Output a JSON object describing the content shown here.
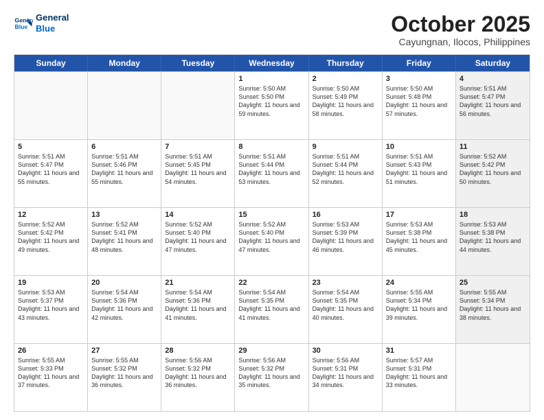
{
  "logo": {
    "line1": "General",
    "line2": "Blue"
  },
  "header": {
    "month": "October 2025",
    "location": "Cayungnan, Ilocos, Philippines"
  },
  "weekdays": [
    "Sunday",
    "Monday",
    "Tuesday",
    "Wednesday",
    "Thursday",
    "Friday",
    "Saturday"
  ],
  "weeks": [
    [
      {
        "day": "",
        "sunrise": "",
        "sunset": "",
        "daylight": "",
        "empty": true
      },
      {
        "day": "",
        "sunrise": "",
        "sunset": "",
        "daylight": "",
        "empty": true
      },
      {
        "day": "",
        "sunrise": "",
        "sunset": "",
        "daylight": "",
        "empty": true
      },
      {
        "day": "1",
        "sunrise": "Sunrise: 5:50 AM",
        "sunset": "Sunset: 5:50 PM",
        "daylight": "Daylight: 11 hours and 59 minutes."
      },
      {
        "day": "2",
        "sunrise": "Sunrise: 5:50 AM",
        "sunset": "Sunset: 5:49 PM",
        "daylight": "Daylight: 11 hours and 58 minutes."
      },
      {
        "day": "3",
        "sunrise": "Sunrise: 5:50 AM",
        "sunset": "Sunset: 5:48 PM",
        "daylight": "Daylight: 11 hours and 57 minutes."
      },
      {
        "day": "4",
        "sunrise": "Sunrise: 5:51 AM",
        "sunset": "Sunset: 5:47 PM",
        "daylight": "Daylight: 11 hours and 56 minutes.",
        "shaded": true
      }
    ],
    [
      {
        "day": "5",
        "sunrise": "Sunrise: 5:51 AM",
        "sunset": "Sunset: 5:47 PM",
        "daylight": "Daylight: 11 hours and 55 minutes."
      },
      {
        "day": "6",
        "sunrise": "Sunrise: 5:51 AM",
        "sunset": "Sunset: 5:46 PM",
        "daylight": "Daylight: 11 hours and 55 minutes."
      },
      {
        "day": "7",
        "sunrise": "Sunrise: 5:51 AM",
        "sunset": "Sunset: 5:45 PM",
        "daylight": "Daylight: 11 hours and 54 minutes."
      },
      {
        "day": "8",
        "sunrise": "Sunrise: 5:51 AM",
        "sunset": "Sunset: 5:44 PM",
        "daylight": "Daylight: 11 hours and 53 minutes."
      },
      {
        "day": "9",
        "sunrise": "Sunrise: 5:51 AM",
        "sunset": "Sunset: 5:44 PM",
        "daylight": "Daylight: 11 hours and 52 minutes."
      },
      {
        "day": "10",
        "sunrise": "Sunrise: 5:51 AM",
        "sunset": "Sunset: 5:43 PM",
        "daylight": "Daylight: 11 hours and 51 minutes."
      },
      {
        "day": "11",
        "sunrise": "Sunrise: 5:52 AM",
        "sunset": "Sunset: 5:42 PM",
        "daylight": "Daylight: 11 hours and 50 minutes.",
        "shaded": true
      }
    ],
    [
      {
        "day": "12",
        "sunrise": "Sunrise: 5:52 AM",
        "sunset": "Sunset: 5:42 PM",
        "daylight": "Daylight: 11 hours and 49 minutes."
      },
      {
        "day": "13",
        "sunrise": "Sunrise: 5:52 AM",
        "sunset": "Sunset: 5:41 PM",
        "daylight": "Daylight: 11 hours and 48 minutes."
      },
      {
        "day": "14",
        "sunrise": "Sunrise: 5:52 AM",
        "sunset": "Sunset: 5:40 PM",
        "daylight": "Daylight: 11 hours and 47 minutes."
      },
      {
        "day": "15",
        "sunrise": "Sunrise: 5:52 AM",
        "sunset": "Sunset: 5:40 PM",
        "daylight": "Daylight: 11 hours and 47 minutes."
      },
      {
        "day": "16",
        "sunrise": "Sunrise: 5:53 AM",
        "sunset": "Sunset: 5:39 PM",
        "daylight": "Daylight: 11 hours and 46 minutes."
      },
      {
        "day": "17",
        "sunrise": "Sunrise: 5:53 AM",
        "sunset": "Sunset: 5:38 PM",
        "daylight": "Daylight: 11 hours and 45 minutes."
      },
      {
        "day": "18",
        "sunrise": "Sunrise: 5:53 AM",
        "sunset": "Sunset: 5:38 PM",
        "daylight": "Daylight: 11 hours and 44 minutes.",
        "shaded": true
      }
    ],
    [
      {
        "day": "19",
        "sunrise": "Sunrise: 5:53 AM",
        "sunset": "Sunset: 5:37 PM",
        "daylight": "Daylight: 11 hours and 43 minutes."
      },
      {
        "day": "20",
        "sunrise": "Sunrise: 5:54 AM",
        "sunset": "Sunset: 5:36 PM",
        "daylight": "Daylight: 11 hours and 42 minutes."
      },
      {
        "day": "21",
        "sunrise": "Sunrise: 5:54 AM",
        "sunset": "Sunset: 5:36 PM",
        "daylight": "Daylight: 11 hours and 41 minutes."
      },
      {
        "day": "22",
        "sunrise": "Sunrise: 5:54 AM",
        "sunset": "Sunset: 5:35 PM",
        "daylight": "Daylight: 11 hours and 41 minutes."
      },
      {
        "day": "23",
        "sunrise": "Sunrise: 5:54 AM",
        "sunset": "Sunset: 5:35 PM",
        "daylight": "Daylight: 11 hours and 40 minutes."
      },
      {
        "day": "24",
        "sunrise": "Sunrise: 5:55 AM",
        "sunset": "Sunset: 5:34 PM",
        "daylight": "Daylight: 11 hours and 39 minutes."
      },
      {
        "day": "25",
        "sunrise": "Sunrise: 5:55 AM",
        "sunset": "Sunset: 5:34 PM",
        "daylight": "Daylight: 11 hours and 38 minutes.",
        "shaded": true
      }
    ],
    [
      {
        "day": "26",
        "sunrise": "Sunrise: 5:55 AM",
        "sunset": "Sunset: 5:33 PM",
        "daylight": "Daylight: 11 hours and 37 minutes."
      },
      {
        "day": "27",
        "sunrise": "Sunrise: 5:55 AM",
        "sunset": "Sunset: 5:32 PM",
        "daylight": "Daylight: 11 hours and 36 minutes."
      },
      {
        "day": "28",
        "sunrise": "Sunrise: 5:56 AM",
        "sunset": "Sunset: 5:32 PM",
        "daylight": "Daylight: 11 hours and 36 minutes."
      },
      {
        "day": "29",
        "sunrise": "Sunrise: 5:56 AM",
        "sunset": "Sunset: 5:32 PM",
        "daylight": "Daylight: 11 hours and 35 minutes."
      },
      {
        "day": "30",
        "sunrise": "Sunrise: 5:56 AM",
        "sunset": "Sunset: 5:31 PM",
        "daylight": "Daylight: 11 hours and 34 minutes."
      },
      {
        "day": "31",
        "sunrise": "Sunrise: 5:57 AM",
        "sunset": "Sunset: 5:31 PM",
        "daylight": "Daylight: 11 hours and 33 minutes."
      },
      {
        "day": "",
        "sunrise": "",
        "sunset": "",
        "daylight": "",
        "empty": true,
        "shaded": true
      }
    ]
  ]
}
